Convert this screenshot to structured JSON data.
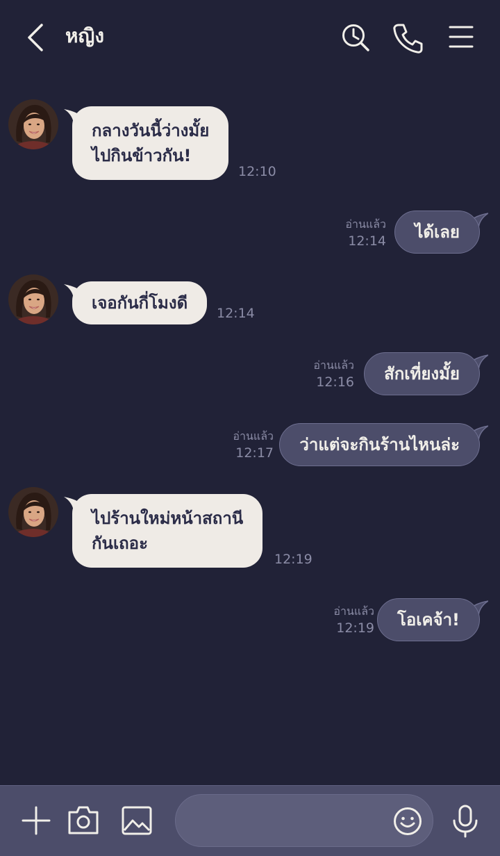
{
  "header": {
    "title": "หญิง"
  },
  "messages": [
    {
      "from": "in",
      "text_line1": "กลางวันนี้ว่างมั้ย",
      "text_line2": "ไปกินข้าวกัน!",
      "time": "12:10"
    },
    {
      "from": "out",
      "text": "ได้เลย",
      "read_label": "อ่านแล้ว",
      "time": "12:14"
    },
    {
      "from": "in",
      "text": "เจอกันกี่โมงดี",
      "time": "12:14"
    },
    {
      "from": "out",
      "text": "สักเที่ยงมั้ย",
      "read_label": "อ่านแล้ว",
      "time": "12:16"
    },
    {
      "from": "out",
      "text": "ว่าแต่จะกินร้านไหนล่ะ",
      "read_label": "อ่านแล้ว",
      "time": "12:17"
    },
    {
      "from": "in",
      "text_line1": "ไปร้านใหม่หน้าสถานี",
      "text_line2": "กันเถอะ",
      "time": "12:19"
    },
    {
      "from": "out",
      "text": "โอเคจ้า!",
      "read_label": "อ่านแล้ว",
      "time": "12:19"
    }
  ],
  "composer": {
    "placeholder": ""
  },
  "icons": {
    "back": "chevron-left-icon",
    "search": "search-clock-icon",
    "call": "phone-icon",
    "menu": "hamburger-menu-icon",
    "plus": "plus-icon",
    "camera": "camera-icon",
    "image": "image-icon",
    "emoji": "smiley-icon",
    "mic": "microphone-icon"
  },
  "colors": {
    "background": "#212237",
    "incoming_bubble": "#efebe6",
    "outgoing_bubble": "#4c4d6a",
    "bottom_bar": "#4c4d6a",
    "icon": "#f1efe9",
    "meta_text": "#8b8ca6"
  }
}
